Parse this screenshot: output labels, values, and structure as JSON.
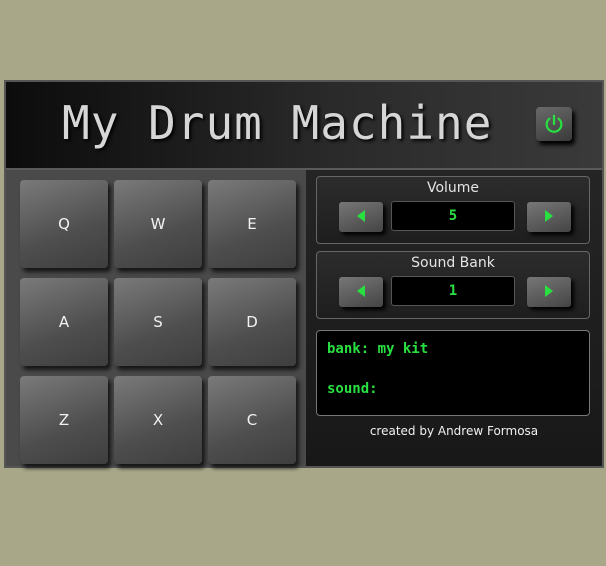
{
  "app": {
    "title": "My Drum Machine"
  },
  "header": {
    "power_icon": "power-icon",
    "power_color": "#29e041"
  },
  "pads": [
    {
      "key": "Q"
    },
    {
      "key": "W"
    },
    {
      "key": "E"
    },
    {
      "key": "A"
    },
    {
      "key": "S"
    },
    {
      "key": "D"
    },
    {
      "key": "Z"
    },
    {
      "key": "X"
    },
    {
      "key": "C"
    }
  ],
  "volume": {
    "label": "Volume",
    "value": "5",
    "decrease_icon": "triangle-left-icon",
    "increase_icon": "triangle-right-icon"
  },
  "sound_bank": {
    "label": "Sound Bank",
    "value": "1",
    "decrease_icon": "triangle-left-icon",
    "increase_icon": "triangle-right-icon"
  },
  "display": {
    "bank_line": "bank: my kit",
    "sound_line": "sound: "
  },
  "footer": {
    "credit": "created by Andrew Formosa"
  },
  "colors": {
    "background": "#a8a889",
    "accent_green": "#29e041",
    "display_bg": "#000000"
  }
}
